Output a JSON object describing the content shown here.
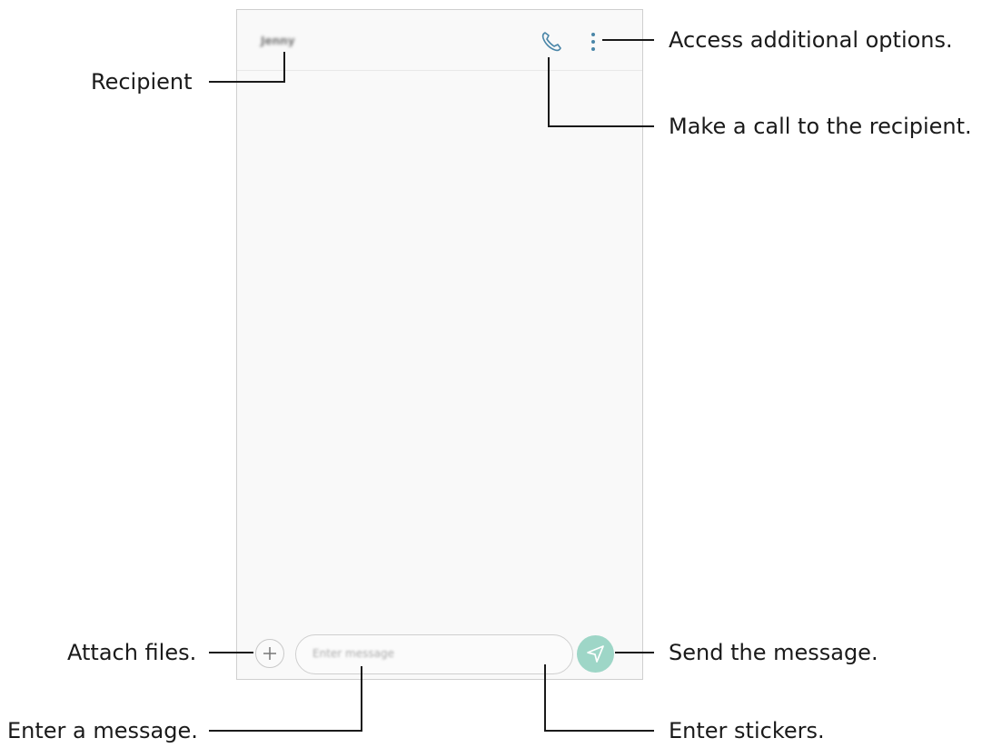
{
  "screen": {
    "header": {
      "recipient_name": "Jenny",
      "call_icon": "phone-icon",
      "more_icon": "more-options-icon"
    },
    "composer": {
      "attach_icon": "plus-icon",
      "placeholder": "Enter message",
      "sticker_icon": "sticker-icon",
      "send_icon": "send-icon",
      "send_color": "#9ed6c7"
    }
  },
  "annotations": {
    "recipient": "Recipient",
    "options": "Access additional options.",
    "call": "Make a call to the recipient.",
    "attach": "Attach files.",
    "send": "Send the message.",
    "enter_message": "Enter a message.",
    "stickers": "Enter stickers."
  }
}
